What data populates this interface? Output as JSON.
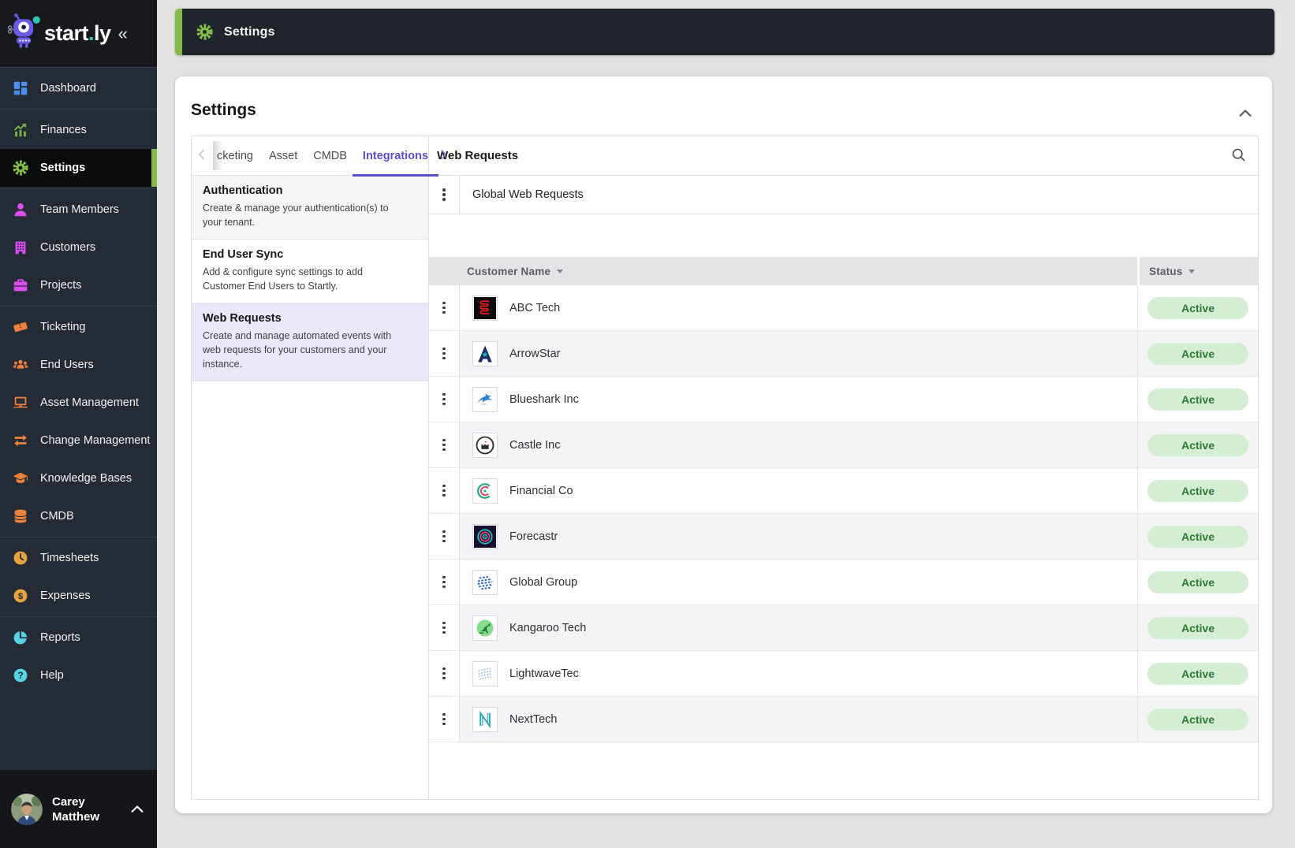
{
  "brand": {
    "word_primary": "start",
    "dot": ".",
    "word_secondary": "ly",
    "collapse_glyph": "«"
  },
  "topbar": {
    "title": "Settings"
  },
  "card": {
    "title": "Settings"
  },
  "sidebar": {
    "groups": [
      {
        "items": [
          {
            "label": "Dashboard",
            "icon": "dashboard",
            "color": "#4A90F4",
            "active": false
          }
        ]
      },
      {
        "items": [
          {
            "label": "Finances",
            "icon": "finances",
            "color": "#7CB342",
            "active": false
          },
          {
            "label": "Settings",
            "icon": "gear",
            "color": "#84BC49",
            "active": true
          }
        ]
      },
      {
        "items": [
          {
            "label": "Team Members",
            "icon": "person",
            "color": "#DD4BF2",
            "active": false
          },
          {
            "label": "Customers",
            "icon": "building",
            "color": "#DD4BF2",
            "active": false
          },
          {
            "label": "Projects",
            "icon": "briefcase",
            "color": "#DD4BF2",
            "active": false
          }
        ]
      },
      {
        "items": [
          {
            "label": "Ticketing",
            "icon": "ticket",
            "color": "#F0813C",
            "active": false
          },
          {
            "label": "End Users",
            "icon": "people",
            "color": "#F0813C",
            "active": false
          },
          {
            "label": "Asset Management",
            "icon": "laptop",
            "color": "#F0813C",
            "active": false
          },
          {
            "label": "Change Management",
            "icon": "swap-arrows",
            "color": "#F0813C",
            "active": false
          },
          {
            "label": "Knowledge Bases",
            "icon": "graduation-cap",
            "color": "#F0813C",
            "active": false
          },
          {
            "label": "CMDB",
            "icon": "database",
            "color": "#F0813C",
            "active": false
          }
        ]
      },
      {
        "items": [
          {
            "label": "Timesheets",
            "icon": "clock",
            "color": "#E8A33D",
            "active": false
          },
          {
            "label": "Expenses",
            "icon": "dollar",
            "color": "#E8A33D",
            "active": false
          }
        ]
      },
      {
        "items": [
          {
            "label": "Reports",
            "icon": "pie-chart",
            "color": "#55D4E4",
            "active": false
          },
          {
            "label": "Help",
            "icon": "question",
            "color": "#55D4E4",
            "active": false
          }
        ]
      }
    ],
    "user": {
      "first_name": "Carey",
      "last_name": "Matthew"
    }
  },
  "tabs": {
    "items": [
      {
        "label": "cketing",
        "active": false
      },
      {
        "label": "Asset",
        "active": false
      },
      {
        "label": "CMDB",
        "active": false
      },
      {
        "label": "Integrations",
        "active": true
      }
    ]
  },
  "submenu": {
    "items": [
      {
        "title": "Authentication",
        "description": "Create & manage your authentication(s) to your tenant.",
        "state": "hover"
      },
      {
        "title": "End User Sync",
        "description": "Add & configure sync settings to add Customer End Users to Startly.",
        "state": "default"
      },
      {
        "title": "Web Requests",
        "description": "Create and manage automated events with web requests for your customers and your instance.",
        "state": "selected"
      }
    ]
  },
  "panel": {
    "title": "Web Requests",
    "global_row_label": "Global Web Requests"
  },
  "table": {
    "columns": [
      {
        "label": "Customer Name",
        "sortable": true
      },
      {
        "label": "Status",
        "sortable": true
      }
    ],
    "rows": [
      {
        "name": "ABC Tech",
        "status": "Active",
        "logo": "abc-tech"
      },
      {
        "name": "ArrowStar",
        "status": "Active",
        "logo": "arrowstar"
      },
      {
        "name": "Blueshark Inc",
        "status": "Active",
        "logo": "blueshark"
      },
      {
        "name": "Castle Inc",
        "status": "Active",
        "logo": "castle"
      },
      {
        "name": "Financial Co",
        "status": "Active",
        "logo": "financial"
      },
      {
        "name": "Forecastr",
        "status": "Active",
        "logo": "forecastr"
      },
      {
        "name": "Global Group",
        "status": "Active",
        "logo": "global-group"
      },
      {
        "name": "Kangaroo Tech",
        "status": "Active",
        "logo": "kangaroo"
      },
      {
        "name": "LightwaveTec",
        "status": "Active",
        "logo": "lightwave"
      },
      {
        "name": "NextTech",
        "status": "Active",
        "logo": "nexttech"
      }
    ]
  },
  "colors": {
    "accent_green": "#84BC49",
    "accent_purple": "#5B4FC8",
    "status_active_bg": "#D5EDD2",
    "status_active_text": "#2C7A33"
  }
}
